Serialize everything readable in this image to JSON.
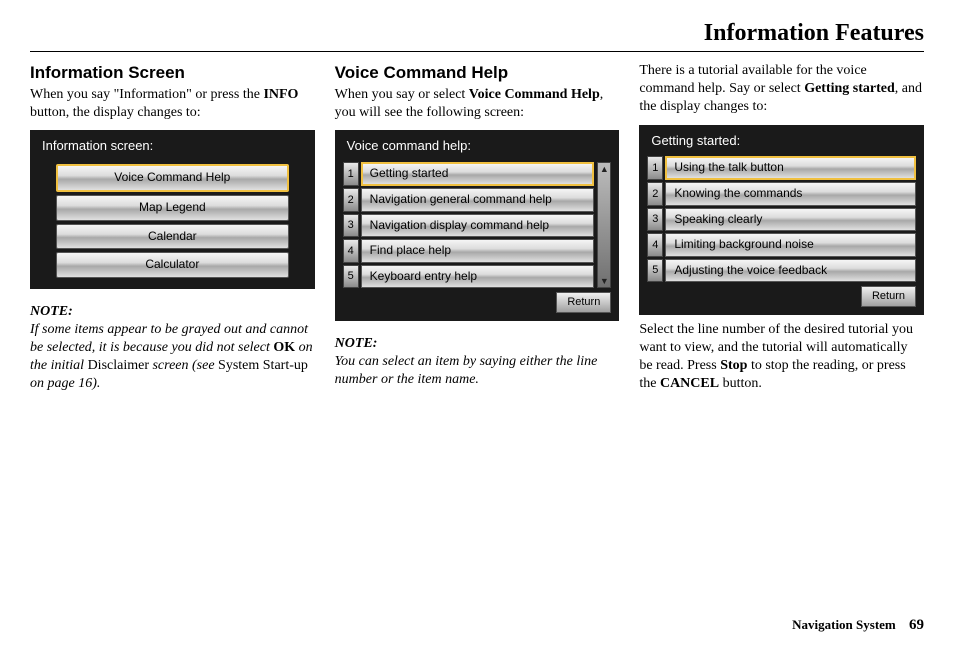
{
  "page_title": "Information Features",
  "footer": {
    "label": "Navigation System",
    "page": "69"
  },
  "col1": {
    "heading": "Information Screen",
    "intro_a": "When you say \"Information\" or press the ",
    "intro_bold": "INFO",
    "intro_b": " button, the display changes to:",
    "screen": {
      "title": "Information screen:",
      "buttons": [
        "Voice Command Help",
        "Map Legend",
        "Calendar",
        "Calculator"
      ]
    },
    "note_label": "NOTE:",
    "note_a": "If some items appear to be grayed out and cannot be selected, it is because you did not select ",
    "note_bold1": "OK",
    "note_b": " on the initial ",
    "note_disclaimer": "Disclaimer",
    "note_c": " screen (see ",
    "note_startup": "System Start-up",
    "note_d": " on page 16)."
  },
  "col2": {
    "heading": "Voice Command Help",
    "intro_a": "When you say or select ",
    "intro_bold": "Voice Command Help",
    "intro_b": ", you will see the following screen:",
    "screen": {
      "title": "Voice command help:",
      "items": [
        {
          "n": "1",
          "label": "Getting started"
        },
        {
          "n": "2",
          "label": "Navigation general command help"
        },
        {
          "n": "3",
          "label": "Navigation display command help"
        },
        {
          "n": "4",
          "label": "Find place help"
        },
        {
          "n": "5",
          "label": "Keyboard entry help"
        }
      ],
      "return": "Return",
      "scroll_up": "▲",
      "scroll_down": "▼"
    },
    "note_label": "NOTE:",
    "note_body": "You can select an item by saying either the line number or the item name."
  },
  "col3": {
    "intro_a": "There is a tutorial available for the voice command help. Say or select ",
    "intro_bold": "Getting started",
    "intro_b": ", and the display changes to:",
    "screen": {
      "title": "Getting started:",
      "items": [
        {
          "n": "1",
          "label": "Using the talk button"
        },
        {
          "n": "2",
          "label": "Knowing the commands"
        },
        {
          "n": "3",
          "label": "Speaking clearly"
        },
        {
          "n": "4",
          "label": "Limiting background noise"
        },
        {
          "n": "5",
          "label": "Adjusting the voice feedback"
        }
      ],
      "return": "Return"
    },
    "after_a": "Select the line number of the desired tutorial you want to view, and the tutorial will automatically be read. Press ",
    "after_bold1": "Stop",
    "after_b": " to stop the reading, or press the ",
    "after_bold2": "CANCEL",
    "after_c": " button."
  }
}
